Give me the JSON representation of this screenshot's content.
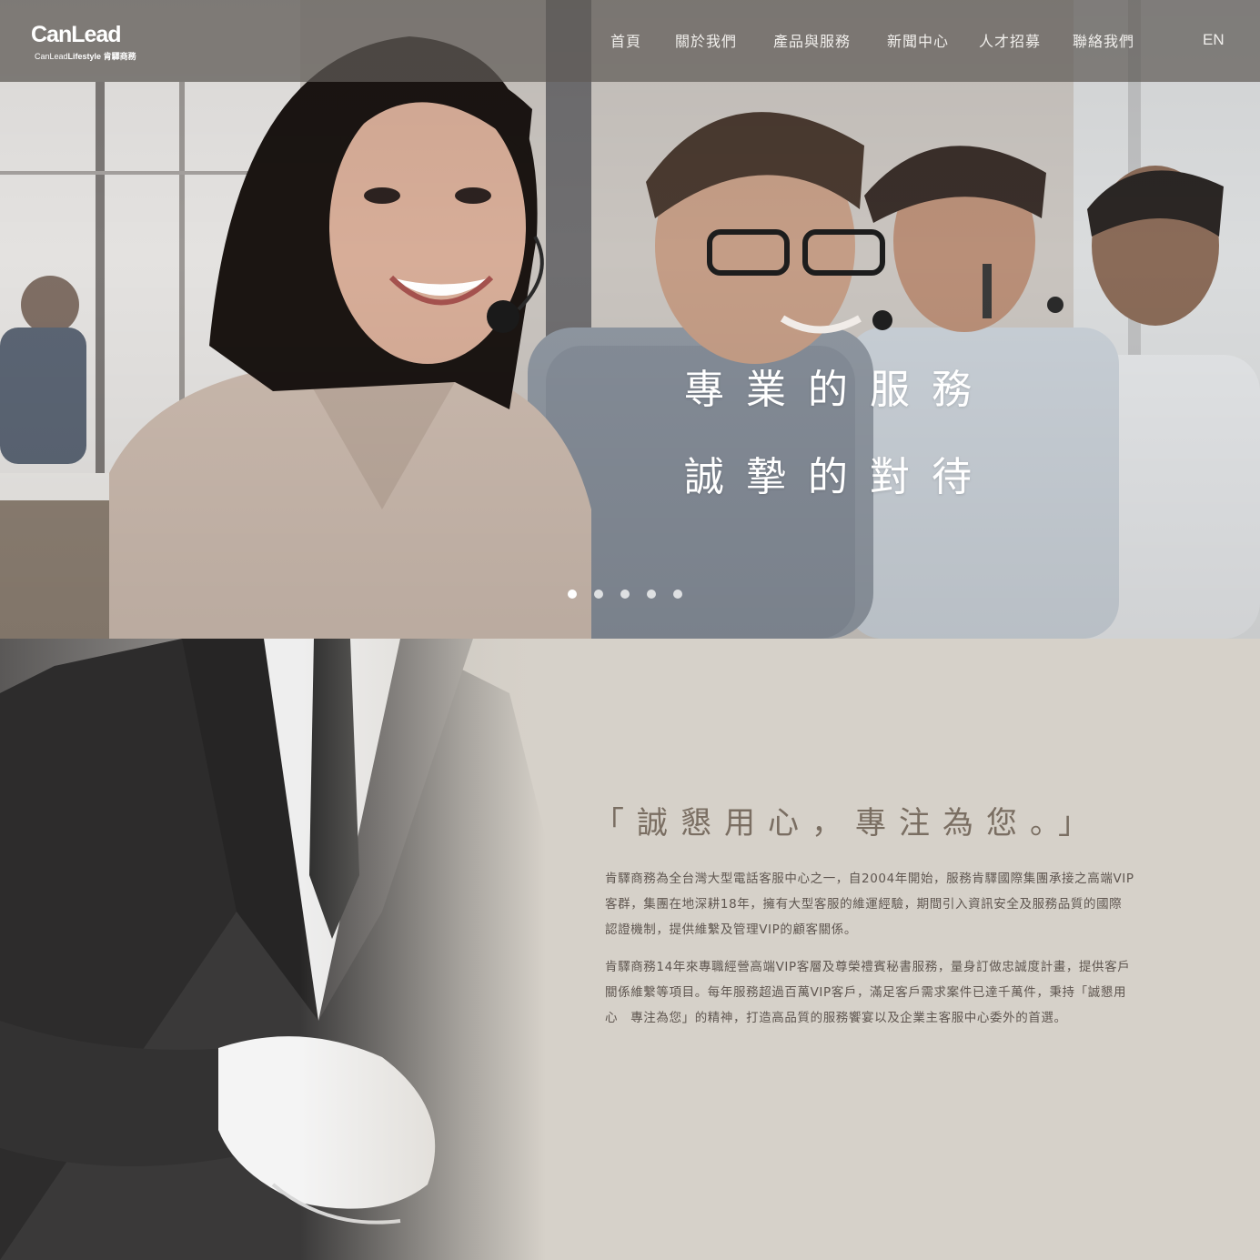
{
  "brand": {
    "logo_main": "CanLead",
    "logo_sub_light": "CanLead",
    "logo_sub_bold": "Lifestyle",
    "logo_sub_cn": "肯驛商務"
  },
  "nav": {
    "items": [
      {
        "label": "首頁"
      },
      {
        "label": "關於我們"
      },
      {
        "label": "產品與服務"
      },
      {
        "label": "新聞中心"
      },
      {
        "label": "人才招募"
      },
      {
        "label": "聯絡我們"
      }
    ],
    "language": "EN"
  },
  "hero": {
    "line1": "專業的服務",
    "line2": "誠摯的對待",
    "slide_count": 5,
    "active_slide": 1
  },
  "about": {
    "quote": "「誠懇用心，專注為您。」",
    "paragraph1_lines": [
      "肯驛商務為全台灣大型電話客服中心之一，自2004年開始，服務肯驛國際集團承接之高端VIP",
      "客群，集團在地深耕18年，擁有大型客服的維運經驗，期間引入資訊安全及服務品質的國際",
      "認證機制，提供維繫及管理VIP的顧客關係。"
    ],
    "paragraph2_lines": [
      "肯驛商務14年來專職經營高端VIP客層及尊榮禮賓秘書服務，量身訂做忠誠度計畫，提供客戶",
      "關係維繫等項目。每年服務超過百萬VIP客戶，滿足客戶需求案件已達千萬件，秉持「誠懇用",
      "心　專注為您」的精神，打造高品質的服務饗宴以及企業主客服中心委外的首選。"
    ]
  },
  "colors": {
    "navbar_bg": "#5f5c58",
    "section_bg": "#d6d1c9",
    "quote_text": "#7a6e62",
    "body_text": "#5f5650"
  }
}
